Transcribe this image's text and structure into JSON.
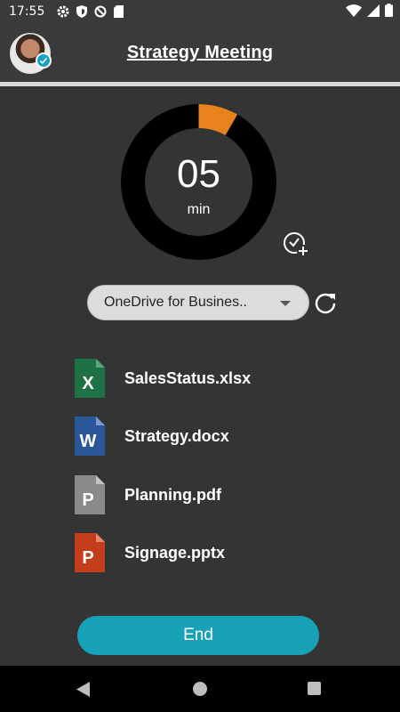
{
  "status_bar": {
    "time": "17:55",
    "left_icons": [
      "gear-icon",
      "shield-icon",
      "blocked-icon",
      "sd-card-icon"
    ],
    "right_icons": [
      "wifi-icon",
      "signal-icon",
      "battery-icon"
    ]
  },
  "header": {
    "title": "Strategy Meeting",
    "avatar_badge": "verified-check-icon"
  },
  "timer": {
    "value": "05",
    "unit": "min",
    "progress_fraction": 0.083,
    "ring_color": "#000000",
    "progress_color": "#e8821a"
  },
  "source": {
    "selected": "OneDrive for Busines.."
  },
  "files": [
    {
      "name": "SalesStatus.xlsx",
      "type": "excel",
      "letter": "X",
      "color": "#1e7145"
    },
    {
      "name": "Strategy.docx",
      "type": "word",
      "letter": "W",
      "color": "#2b579a"
    },
    {
      "name": "Planning.pdf",
      "type": "pdf",
      "letter": "P",
      "color": "#8a8a8a"
    },
    {
      "name": "Signage.pptx",
      "type": "powerpoint",
      "letter": "P",
      "color": "#c43e1c"
    }
  ],
  "actions": {
    "end_label": "End",
    "end_color": "#17a2b8"
  },
  "nav": {
    "buttons": [
      "back-icon",
      "home-icon",
      "recents-icon"
    ]
  }
}
